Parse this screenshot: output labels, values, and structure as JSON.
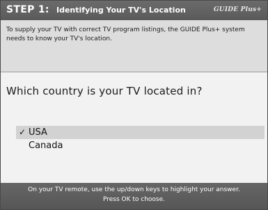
{
  "header": {
    "step": "STEP 1:",
    "title": "Identifying Your TV's Location",
    "logo": "GUIDE Plus+"
  },
  "intro": {
    "text": "To supply your TV with correct TV program listings, the GUIDE Plus+ system needs to know your TV's location."
  },
  "question": "Which country is your TV located in?",
  "options": [
    {
      "label": "USA",
      "selected": true,
      "check": "✓"
    },
    {
      "label": "Canada",
      "selected": false,
      "check": ""
    }
  ],
  "footer": {
    "line1": "On your TV remote, use the up/down keys to highlight your answer.",
    "line2": "Press OK to choose."
  },
  "colors": {
    "header_bg": "#5f5f5f",
    "intro_bg": "#dddddd",
    "body_bg": "#f2f2f2",
    "highlight_bg": "#d2d2d2"
  }
}
